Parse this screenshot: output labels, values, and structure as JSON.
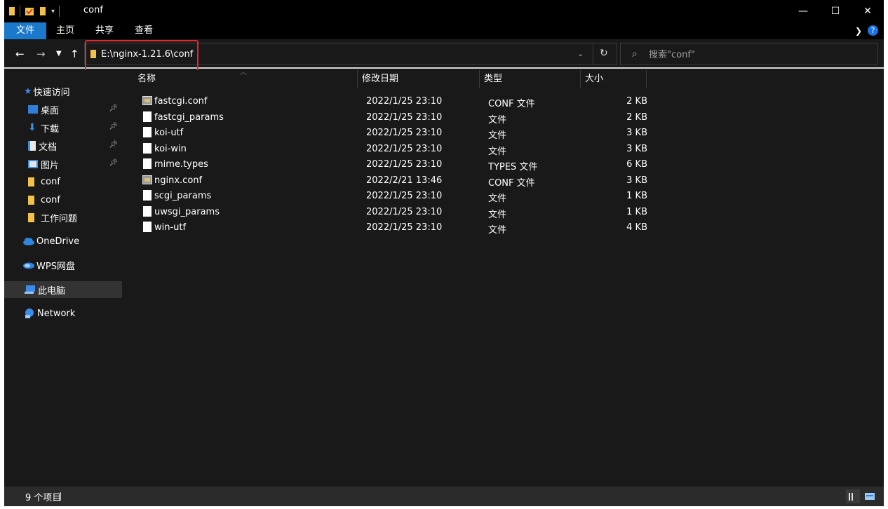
{
  "window": {
    "title": "conf",
    "controls": {
      "minimize": "—",
      "maximize": "☐",
      "close": "✕"
    }
  },
  "ribbon": {
    "tabs": [
      "文件",
      "主页",
      "共享",
      "查看"
    ],
    "help_icon": "?"
  },
  "address": {
    "path": "E:\\nginx-1.21.6\\conf",
    "search_placeholder": "搜索\"conf\""
  },
  "sidebar": {
    "quick_access": "快速访问",
    "items": [
      {
        "label": "桌面",
        "icon": "desktop-icon",
        "pinned": true
      },
      {
        "label": "下载",
        "icon": "download-icon",
        "pinned": true
      },
      {
        "label": "文档",
        "icon": "document-icon",
        "pinned": true
      },
      {
        "label": "图片",
        "icon": "picture-icon",
        "pinned": true
      },
      {
        "label": "conf",
        "icon": "folder-icon",
        "pinned": false
      },
      {
        "label": "conf",
        "icon": "folder-icon",
        "pinned": false
      },
      {
        "label": "工作问题",
        "icon": "folder-icon",
        "pinned": false
      }
    ],
    "onedrive": "OneDrive",
    "wps": "WPS网盘",
    "this_pc": "此电脑",
    "network": "Network"
  },
  "columns": {
    "name": "名称",
    "date": "修改日期",
    "type": "类型",
    "size": "大小"
  },
  "files": [
    {
      "name": "fastcgi.conf",
      "date": "2022/1/25 23:10",
      "type": "CONF 文件",
      "size": "2 KB",
      "icon": "conf-file-icon"
    },
    {
      "name": "fastcgi_params",
      "date": "2022/1/25 23:10",
      "type": "文件",
      "size": "2 KB",
      "icon": "file-icon"
    },
    {
      "name": "koi-utf",
      "date": "2022/1/25 23:10",
      "type": "文件",
      "size": "3 KB",
      "icon": "file-icon"
    },
    {
      "name": "koi-win",
      "date": "2022/1/25 23:10",
      "type": "文件",
      "size": "3 KB",
      "icon": "file-icon"
    },
    {
      "name": "mime.types",
      "date": "2022/1/25 23:10",
      "type": "TYPES 文件",
      "size": "6 KB",
      "icon": "file-icon"
    },
    {
      "name": "nginx.conf",
      "date": "2022/2/21 13:46",
      "type": "CONF 文件",
      "size": "3 KB",
      "icon": "conf-file-icon"
    },
    {
      "name": "scgi_params",
      "date": "2022/1/25 23:10",
      "type": "文件",
      "size": "1 KB",
      "icon": "file-icon"
    },
    {
      "name": "uwsgi_params",
      "date": "2022/1/25 23:10",
      "type": "文件",
      "size": "1 KB",
      "icon": "file-icon"
    },
    {
      "name": "win-utf",
      "date": "2022/1/25 23:10",
      "type": "文件",
      "size": "4 KB",
      "icon": "file-icon"
    }
  ],
  "status": {
    "count": "9 个项目"
  },
  "colors": {
    "accent": "#1979ca",
    "highlight": "#e8242c",
    "background": "#191919"
  }
}
